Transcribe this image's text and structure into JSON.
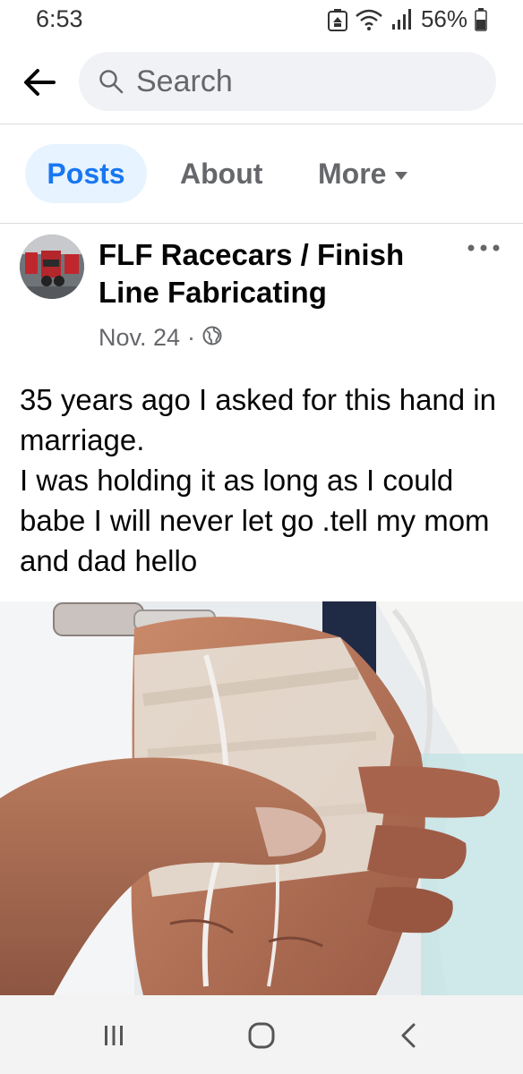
{
  "status_bar": {
    "time": "6:53",
    "battery": "56%",
    "icons": [
      "recycle-notification-icon",
      "wifi-icon",
      "signal-icon",
      "battery-icon"
    ]
  },
  "search": {
    "placeholder": "Search",
    "back_icon": "back-arrow-icon",
    "search_icon": "search-icon"
  },
  "tabs": [
    {
      "label": "Posts",
      "active": true
    },
    {
      "label": "About",
      "active": false
    },
    {
      "label": "More",
      "active": false
    }
  ],
  "post": {
    "author": "FLF Racecars / Finish Line Fabricating",
    "date": "Nov. 24",
    "separator": "·",
    "privacy_icon": "globe-icon",
    "text": "35 years ago I asked for this hand in marriage.\nI was holding it as long as I could babe I will never let go .tell my mom and dad hello",
    "photo_icon": "photo-of-held-hands"
  },
  "nav_bar": {
    "icons": [
      "recent-apps-icon",
      "home-icon",
      "back-icon"
    ]
  },
  "colors": {
    "accent": "#1877f2",
    "tab_active_bg": "#e7f3ff",
    "secondary_text": "#65676b",
    "search_bg": "#f0f2f5"
  }
}
